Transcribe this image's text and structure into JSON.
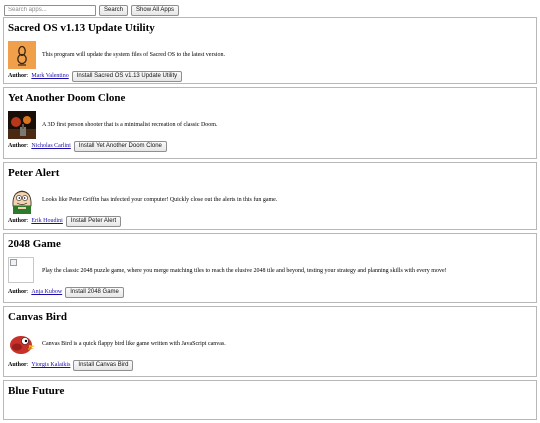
{
  "search": {
    "placeholder": "Search apps...",
    "button": "Search",
    "show_all": "Show All Apps"
  },
  "author_label": "Author",
  "apps": [
    {
      "title": "Sacred OS v1.13 Update Utility",
      "description": "This program will update the system files of Sacred OS to the latest version.",
      "author": "Mark Valentino",
      "install_label": "Install Sacred OS v1.13 Update Utility",
      "icon": "sacred-os-icon"
    },
    {
      "title": "Yet Another Doom Clone",
      "description": "A 3D first person shooter that is a minimalist recreation of classic Doom.",
      "author": "Nicholas Carlini",
      "install_label": "Install Yet Another Doom Clone",
      "icon": "doom-clone-icon"
    },
    {
      "title": "Peter Alert",
      "description": "Looks like Peter Griffin has infected your computer! Quickly close out the alerts in this fun game.",
      "author": "Erik Houdini",
      "install_label": "Install Peter Alert",
      "icon": "peter-griffin-icon"
    },
    {
      "title": "2048 Game",
      "description": "Play the classic 2048 puzzle game, where you merge matching tiles to reach the elusive 2048 tile and beyond, testing your strategy and planning skills with every move!",
      "author": "Anja Kubow",
      "install_label": "Install 2048 Game",
      "icon": "broken-image-icon"
    },
    {
      "title": "Canvas Bird",
      "description": "Canvas Bird is a quick flappy bird like game written with JavaScript canvas.",
      "author": "Yiorgis Kalaikis",
      "install_label": "Install Canvas Bird",
      "icon": "bird-icon"
    },
    {
      "title": "Blue Future"
    }
  ],
  "colors": {
    "link": "#1a0dab",
    "border": "#b8b8b8",
    "sacred_icon_bg": "#f0a04a"
  }
}
